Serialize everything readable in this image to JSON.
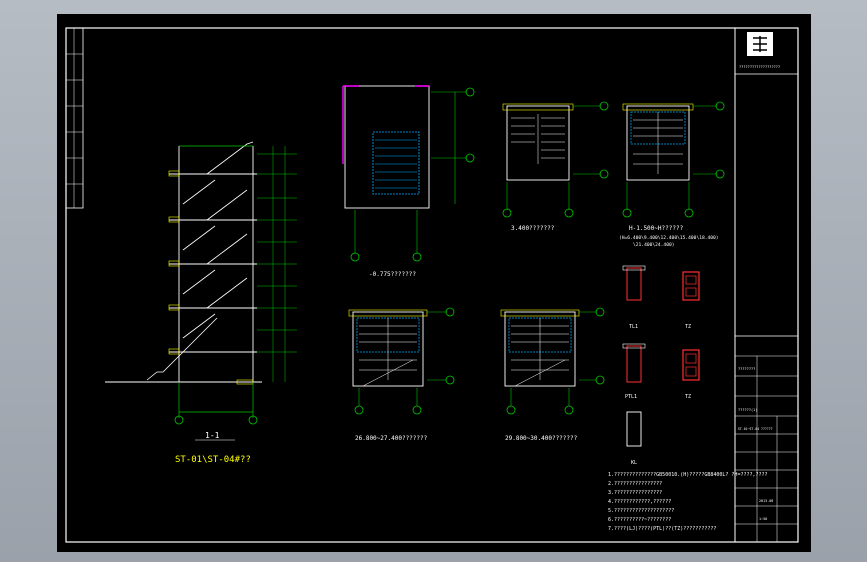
{
  "colors": {
    "background": "#a3aab2",
    "sheet": "#000000",
    "frame": "#ffffff",
    "structure": "#ffffff",
    "axis": "#00c800",
    "dimension": "#00c8c8",
    "title_text": "#ffff00",
    "concrete_hatch": "#00aaff",
    "accent_red": "#ff3030",
    "magenta": "#ff00ff"
  },
  "drawings": {
    "section_1_1": {
      "title": "1-1",
      "subtitle": "ST-01\\ST-04#??"
    },
    "plan_0775": {
      "title": "-0.775???????"
    },
    "plan_3400": {
      "title": "3.400???????"
    },
    "plan_h1500": {
      "title": "H-1.500~H??????",
      "sub": "(H=6.400\\9.400\\12.400\\15.400\\18.400)",
      "sub2": "\\21.400\\24.400)"
    },
    "plan_26800": {
      "title": "26.800~27.400???????"
    },
    "plan_29800": {
      "title": "29.800~30.400???????"
    }
  },
  "details": [
    {
      "label": "TL1"
    },
    {
      "label": "TZ"
    },
    {
      "label": "PTL1"
    },
    {
      "label": "TZ"
    },
    {
      "label": "KL"
    }
  ],
  "notes": [
    "1.??????????????GB50010.(H)?????GB8400L? ?H=????,????",
    "2.????????????????",
    "3.????????????????",
    "4.????????????,??????",
    "5.????????????????????",
    "6.??????????~????????",
    "7.????(LJ)????(PTL)??(TZ)???????????"
  ],
  "title_block": {
    "company": "???????????????????",
    "project": "????????",
    "drawing_name": "??????(1)",
    "drawing_no": "ST-01~ST-04 ??????",
    "date": "2013.08",
    "scale": "1:50"
  }
}
